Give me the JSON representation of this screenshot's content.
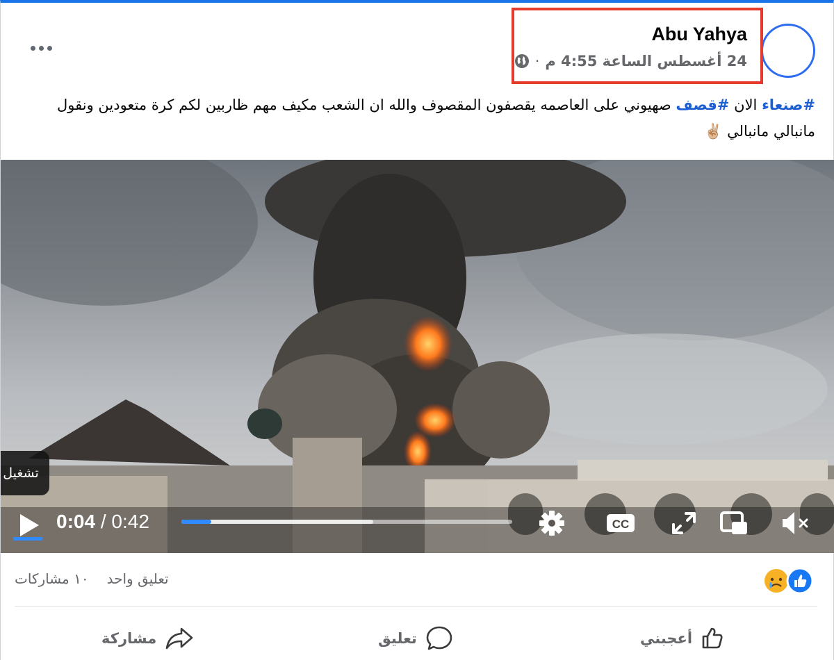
{
  "post": {
    "author": "Abu Yahya",
    "date": "24 أغسطس الساعة 4:55 م",
    "separator": "·",
    "text": {
      "hashtag_1": "#صنعاء",
      "segment_1": " الان  ",
      "hashtag_2": "#قصف",
      "segment_2": " صهيوني على العاصمه  يقصفون المقصوف والله  ان الشعب مكيف مهم ظاربين لكم كرة  متعودين ونقول مانبالي مانبالي ",
      "emoji": "✌🏼"
    }
  },
  "video": {
    "tooltip": "تشغيل",
    "current_time": "0:04",
    "duration": "0:42",
    "time_separator": " / ",
    "progress_played": 0.09,
    "progress_buffered": 0.58
  },
  "stats": {
    "comments": "تعليق واحد",
    "shares": "١٠ مشاركات"
  },
  "actions": {
    "like": "أعجبني",
    "comment": "تعليق",
    "share": "مشاركة"
  },
  "colors": {
    "accent": "#1877f2",
    "highlight": "#e53b2c",
    "hashtag": "#1b5fd2"
  },
  "icons": {
    "more": "more-icon",
    "globe": "globe-icon",
    "play": "play-icon",
    "settings": "gear-icon",
    "captions": "cc-icon",
    "fullscreen": "fullscreen-icon",
    "pip": "picture-in-picture-icon",
    "volume": "volume-muted-icon",
    "like_reaction": "like-reaction-icon",
    "sad_reaction": "sad-reaction-icon"
  }
}
